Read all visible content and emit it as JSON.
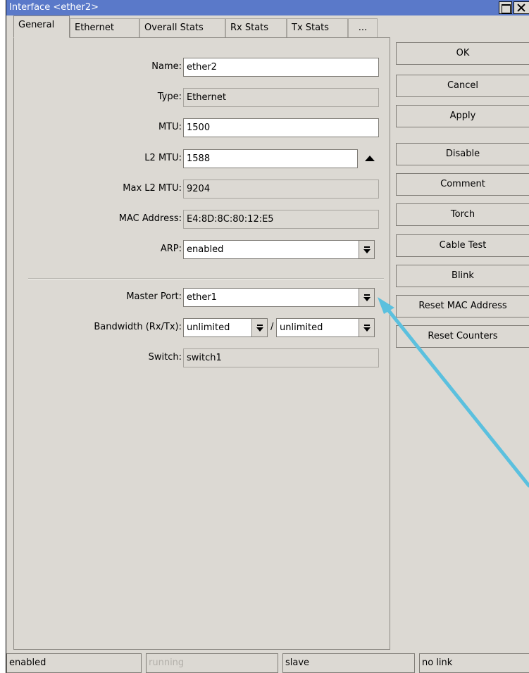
{
  "window": {
    "title": "Interface <ether2>"
  },
  "tabs": [
    "General",
    "Ethernet",
    "Overall Stats",
    "Rx Stats",
    "Tx Stats",
    "..."
  ],
  "form": {
    "name": {
      "label": "Name:",
      "value": "ether2"
    },
    "type": {
      "label": "Type:",
      "value": "Ethernet"
    },
    "mtu": {
      "label": "MTU:",
      "value": "1500"
    },
    "l2mtu": {
      "label": "L2 MTU:",
      "value": "1588"
    },
    "max_l2mtu": {
      "label": "Max L2 MTU:",
      "value": "9204"
    },
    "mac": {
      "label": "MAC Address:",
      "value": "E4:8D:8C:80:12:E5"
    },
    "arp": {
      "label": "ARP:",
      "value": "enabled"
    },
    "master_port": {
      "label": "Master Port:",
      "value": "ether1"
    },
    "bandwidth": {
      "label": "Bandwidth (Rx/Tx):",
      "rx": "unlimited",
      "sep": "/",
      "tx": "unlimited"
    },
    "switch": {
      "label": "Switch:",
      "value": "switch1"
    }
  },
  "buttons": {
    "ok": "OK",
    "cancel": "Cancel",
    "apply": "Apply",
    "disable": "Disable",
    "comment": "Comment",
    "torch": "Torch",
    "cable_test": "Cable Test",
    "blink": "Blink",
    "reset_mac": "Reset MAC Address",
    "reset_counters": "Reset Counters"
  },
  "status": [
    "enabled",
    "running",
    "slave",
    "no link"
  ],
  "colors": {
    "titlebar": "#5a79c9",
    "window_bg": "#dcd9d3",
    "annotation_arrow": "#5bc0de"
  }
}
